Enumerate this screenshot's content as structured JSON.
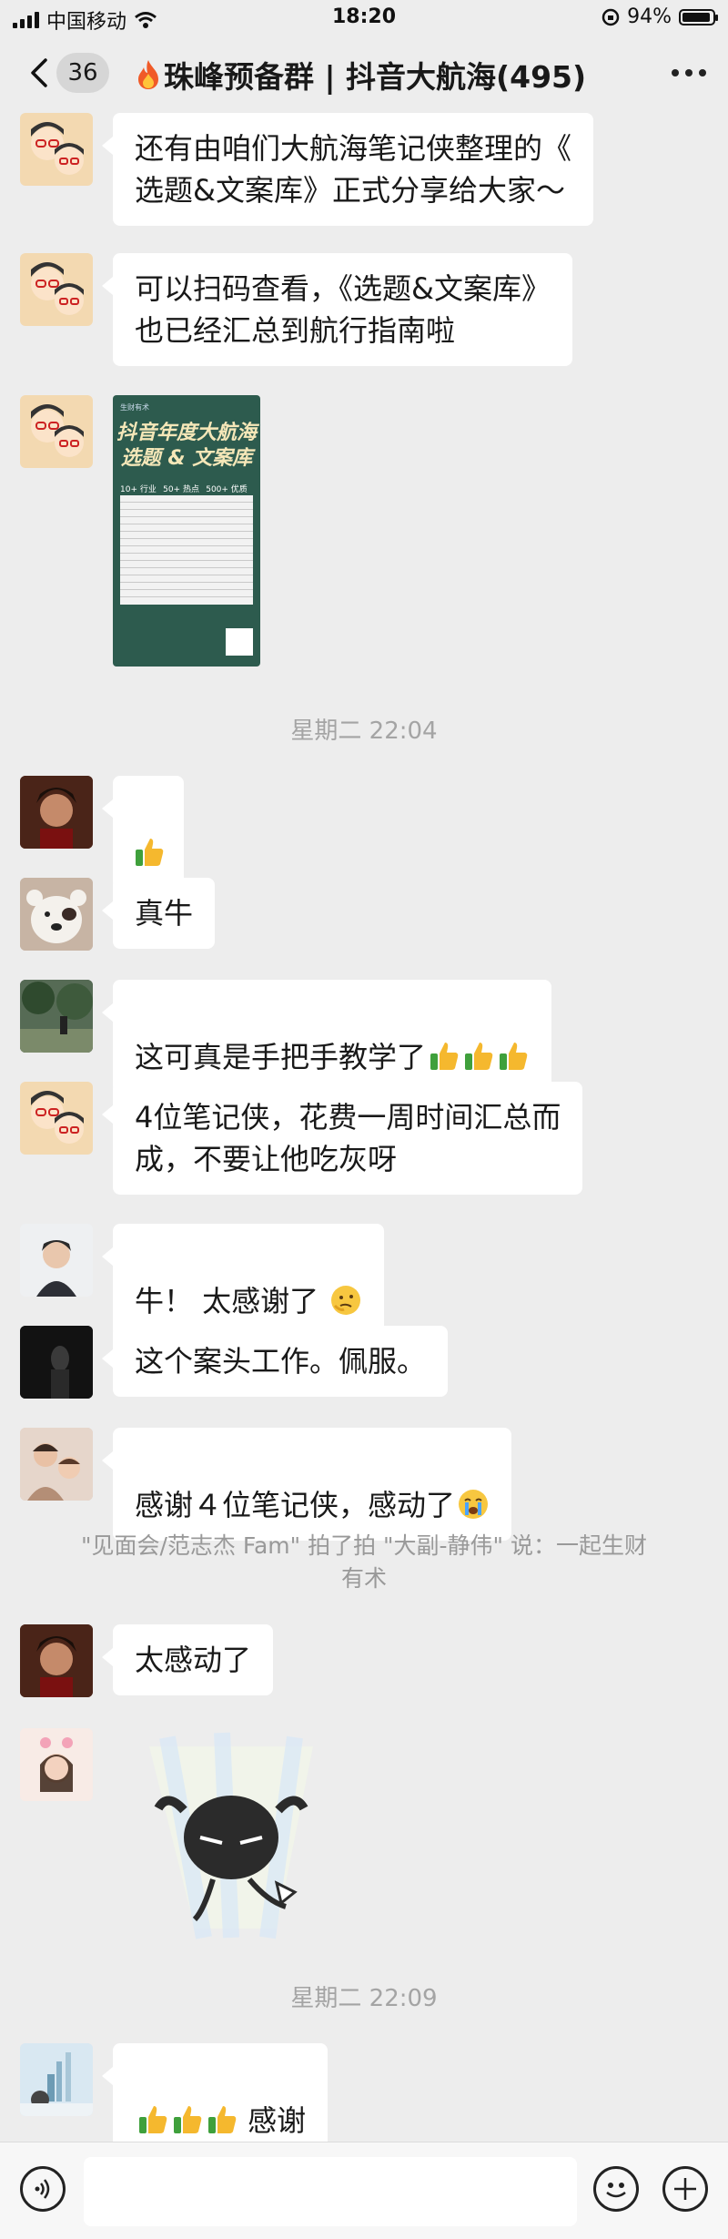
{
  "status_bar": {
    "carrier": "中国移动",
    "time": "18:20",
    "battery": "94%",
    "battery_level": 0.94
  },
  "nav": {
    "back_count": "36",
    "title": "珠峰预备群 | 抖音大航海(495)"
  },
  "messages": [
    {
      "text": "还有由咱们大航海笔记侠整理的《\n选题&文案库》正式分享给大家～"
    },
    {
      "text": "可以扫码查看，《选题&文案库》\n也已经汇总到航行指南啦"
    },
    {
      "poster_title": "抖音年度大航海\n选题 & 文案库",
      "poster_brand": "生财有术",
      "poster_stats": [
        "10+ 行业分类",
        "50+ 热点赛道",
        "500+ 优质文案"
      ]
    },
    {
      "time": "星期二 22:04"
    },
    {
      "text": ""
    },
    {
      "text": "真牛"
    },
    {
      "text": "这可真是手把手教学了"
    },
    {
      "text": "4位笔记侠，花费一周时间汇总而\n成，不要让他吃灰呀"
    },
    {
      "text": "牛！ 太感谢了 "
    },
    {
      "text": "这个案头工作。佩服。"
    },
    {
      "text": "感谢４位笔记侠，感动了"
    },
    {
      "system": "\"见面会/范志杰 Fam\" 拍了拍 \"大副-静伟\" 说：一起生财\n有术"
    },
    {
      "text": "太感动了"
    },
    {
      "time": "星期二 22:09"
    },
    {
      "text": " 感谢"
    }
  ],
  "colors": {
    "background": "#ededed",
    "bubble": "#ffffff",
    "poster": "#2d5b4e"
  },
  "icons": [
    "signal-icon",
    "wifi-icon",
    "lock-rotation-icon",
    "battery-icon",
    "back-arrow-icon",
    "fire-emoji-icon",
    "more-icon",
    "thumbs-up-emoji-icon",
    "thinking-emoji-icon",
    "crying-emoji-icon",
    "voice-icon",
    "emoji-icon",
    "plus-icon"
  ]
}
